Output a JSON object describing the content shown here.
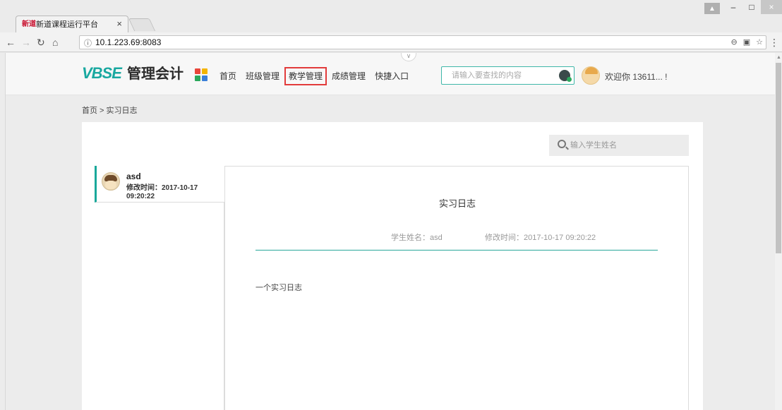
{
  "browser": {
    "tab_favicon": "新道",
    "tab_title": "新道课程运行平台",
    "tab_close": "×",
    "url": "10.1.223.69:8083",
    "omnibox_info": "ⓘ"
  },
  "header": {
    "logo_brand": "VBSE",
    "logo_text": "管理会计",
    "nav": [
      "首页",
      "班级管理",
      "教学管理",
      "成绩管理",
      "快捷入口"
    ],
    "active_nav": "教学管理",
    "search_placeholder": "请输入要查找的内容",
    "welcome": "欢迎你 13611... !"
  },
  "breadcrumb": "首页 > 实习日志",
  "student_search": {
    "placeholder": "输入学生姓名"
  },
  "student_list": [
    {
      "name": "asd",
      "time_label": "修改时间：2017-10-17",
      "time_clock": "09:20:22"
    }
  ],
  "diary": {
    "title": "实习日志",
    "student_name": "学生姓名：asd",
    "modified_time": "修改时间：2017-10-17 09:20:22",
    "body": "一个实习日志"
  },
  "colors": {
    "accent": "#19a89a",
    "highlight_border": "#e23b3b",
    "grid_icon": [
      "#e8463b",
      "#f4b400",
      "#2aa85c",
      "#3b7fd9"
    ]
  }
}
